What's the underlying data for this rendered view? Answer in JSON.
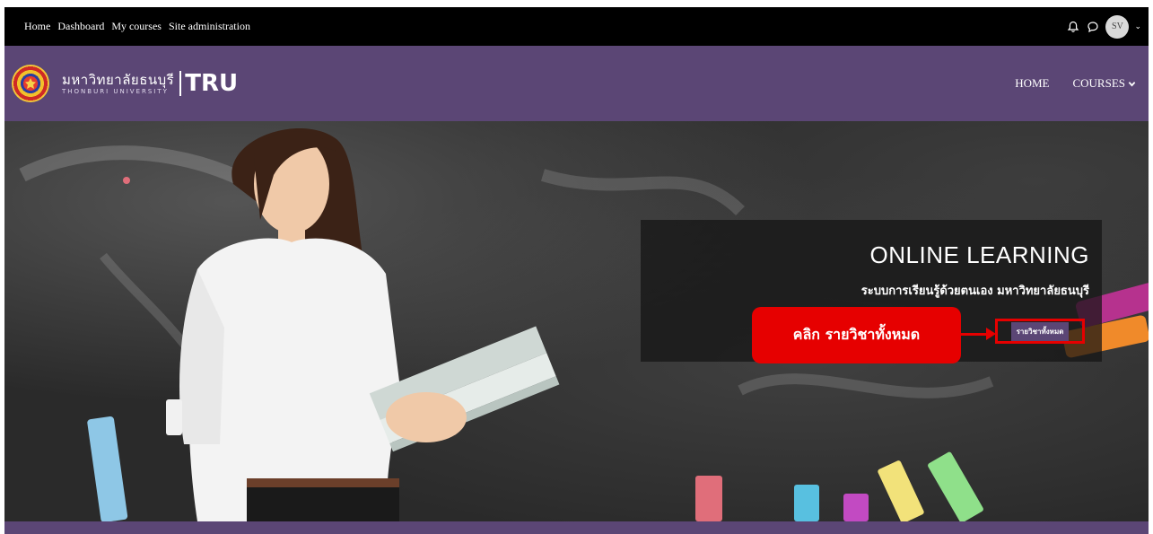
{
  "topbar": {
    "links": [
      "Home",
      "Dashboard",
      "My courses",
      "Site administration"
    ],
    "avatar_initials": "SV"
  },
  "header": {
    "logo_thai": "มหาวิทยาลัยธนบุรี",
    "logo_english": "THONBURI UNIVERSITY",
    "logo_abbr": "TRU",
    "nav_home": "HOME",
    "nav_courses": "COURSES"
  },
  "hero": {
    "title": "ONLINE LEARNING",
    "subtitle": "ระบบการเรียนรู้ด้วยตนเอง มหาวิทยาลัยธนบุรี",
    "all_courses_button": "รายวิชาทั้งหมด",
    "callout": "คลิก รายวิชาทั้งหมด"
  },
  "colors": {
    "topbar": "#000000",
    "brand_purple": "#5b4675",
    "annotation_red": "#e60000"
  },
  "icons": [
    "bell-icon",
    "chat-icon",
    "chevron-down-icon"
  ]
}
